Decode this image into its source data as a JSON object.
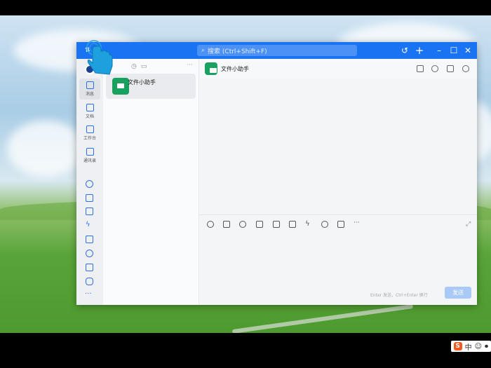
{
  "window": {
    "search_placeholder": "搜索 (Ctrl+Shift+F)",
    "accent_color": "#1a73f2"
  },
  "nav": {
    "items": [
      {
        "label": "消息"
      },
      {
        "label": "文档"
      },
      {
        "label": "工作台"
      },
      {
        "label": "通讯录"
      }
    ],
    "more": "···"
  },
  "chatlist": {
    "more": "···",
    "items": [
      {
        "name": "文件小助手"
      }
    ]
  },
  "conversation": {
    "title": "文件小助手",
    "hint": "Enter 发送，Ctrl+Enter 换行",
    "send_label": "发送",
    "more_tools": "···"
  },
  "taskbar": {
    "ime_logo": "S",
    "ime_lang": "中"
  }
}
